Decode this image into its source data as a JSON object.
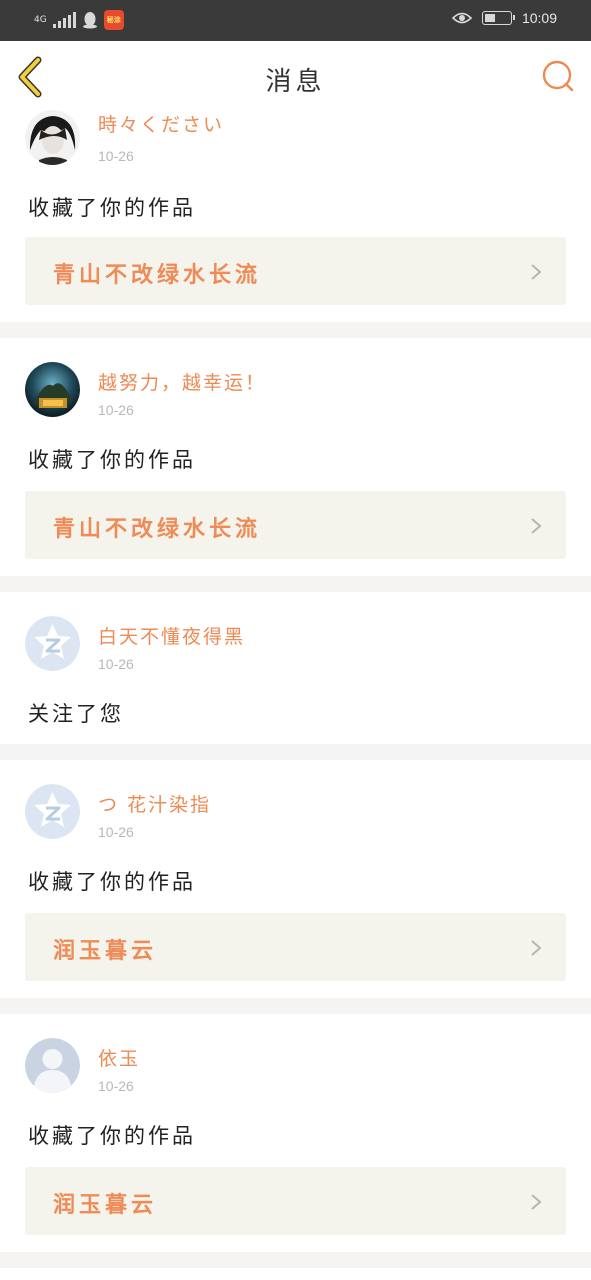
{
  "status_bar": {
    "network": "4G",
    "app_badge": "秘涂",
    "time": "10:09"
  },
  "header": {
    "title": "消息"
  },
  "icons": {
    "back": "chevron-left-icon",
    "search": "search-icon",
    "chevron": "chevron-right-icon"
  },
  "colors": {
    "accent": "#ee8a52",
    "back_arrow": "#f3d03a",
    "card_link_bg": "#f4f3ec"
  },
  "messages": [
    {
      "username": "時々ください",
      "date": "10-26",
      "action": "收藏了你的作品",
      "work_title": "青山不改绿水长流"
    },
    {
      "username": "越努力，越幸运！",
      "date": "10-26",
      "action": "收藏了你的作品",
      "work_title": "青山不改绿水长流"
    },
    {
      "username": "白天不懂夜得黑",
      "date": "10-26",
      "action": "关注了您"
    },
    {
      "username": "つ 花汁染指",
      "date": "10-26",
      "action": "收藏了你的作品",
      "work_title": "润玉暮云"
    },
    {
      "username": "依玉",
      "date": "10-26",
      "action": "收藏了你的作品",
      "work_title": "润玉暮云"
    }
  ]
}
